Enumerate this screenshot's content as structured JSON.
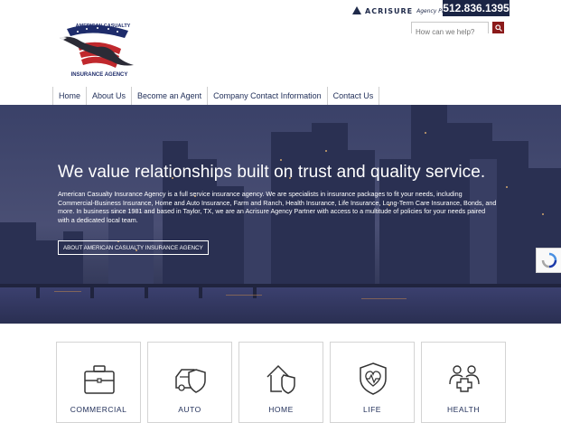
{
  "header": {
    "logo_lines": [
      "AMERICAN CASUALTY",
      "INSURANCE AGENCY"
    ],
    "partner_brand": "ACRISURE",
    "partner_sub": "Agency Partner",
    "phone": "512.836.1395",
    "search_placeholder": "How can we help?"
  },
  "nav": {
    "items": [
      "Home",
      "About Us",
      "Become an Agent",
      "Company Contact Information",
      "Contact Us"
    ]
  },
  "hero": {
    "title": "We value relationships built on trust and quality service.",
    "body": "American Casualty Insurance Agency is a full service insurance agency. We are specialists in insurance packages to fit your needs, including Commercial-Business Insurance, Home and Auto Insurance, Farm and Ranch, Health Insurance, Life Insurance, Long-Term Care Insurance, Bonds, and more. In business since 1981 and based in Taylor, TX, we are an Acrisure Agency Partner with access to a multitude of policies for your needs paired with a dedicated local team.",
    "button_label": "ABOUT AMERICAN CASUALTY INSURANCE AGENCY"
  },
  "cards": [
    {
      "label": "COMMERCIAL",
      "icon": "briefcase-icon"
    },
    {
      "label": "AUTO",
      "icon": "car-shield-icon"
    },
    {
      "label": "HOME",
      "icon": "house-shield-icon"
    },
    {
      "label": "LIFE",
      "icon": "heart-shield-icon"
    },
    {
      "label": "HEALTH",
      "icon": "people-cross-icon"
    }
  ],
  "colors": {
    "navy": "#1a2444",
    "nav_text": "#22305a",
    "search_button": "#8b1a1a",
    "hero_overlay": "#2c3356"
  }
}
